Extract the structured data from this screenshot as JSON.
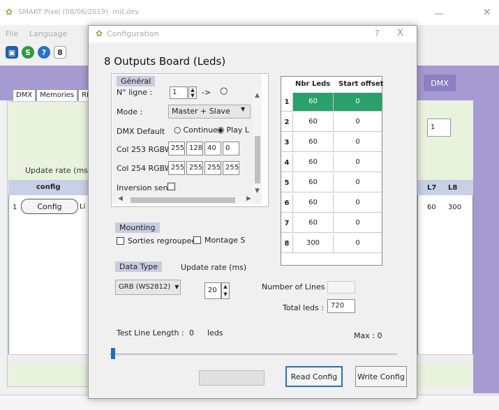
{
  "main_window": {
    "title": "SMART Pixel (08/06/2019)",
    "subtitle": "mit.dev",
    "menu": [
      "File",
      "Language"
    ],
    "toolbar_icons": [
      "save-icon",
      "s-icon",
      "help-icon",
      "8-icon"
    ],
    "tabs": [
      "DMX",
      "Memories",
      "RD"
    ],
    "update_rate_label": "Update rate (ms)",
    "table": {
      "config_header": "config",
      "row_index": "1",
      "config_button": "Config",
      "row_partial": "Li",
      "l7_header": "L7",
      "l8_header": "L8",
      "l7_value": "60",
      "l8_value": "300"
    },
    "dmx_button": "DMX",
    "right_spin_value": "1"
  },
  "dialog": {
    "title": "Configuration",
    "help": "?",
    "close": "X",
    "heading": "8 Outputs Board (Leds)",
    "general": {
      "header": "Général",
      "ligne_label": "N° ligne :",
      "ligne_value": "1",
      "ligne_arrow": "->",
      "mode_label": "Mode :",
      "mode_value": "Master + Slave",
      "dmx_default_label": "DMX Default",
      "dmx_options": [
        "Continue",
        "Play L"
      ],
      "dmx_selected": "Play L",
      "col253_label": "Col 253 RGBW",
      "col253_values": [
        "255",
        "128",
        "40",
        "0"
      ],
      "col254_label": "Col 254 RGBW",
      "col254_values": [
        "255",
        "255",
        "255",
        "255"
      ],
      "inversion_label": "Inversion sens"
    },
    "mounting": {
      "header": "Mounting",
      "sorties_label": "Sorties regroupee",
      "montage_label": "Montage S"
    },
    "data_type": {
      "header": "Data Type",
      "selected": "GRB (WS2812)",
      "update_rate_label": "Update rate (ms)",
      "update_rate_value": "20"
    },
    "number_of_lines_label": "Number of Lines :",
    "total_leds_label": "Total leds :",
    "total_leds_value": "720",
    "test_line_label": "Test Line Length :",
    "test_line_value": "0",
    "test_line_unit": "leds",
    "max_label": "Max : 0",
    "slider_value": 0,
    "buttons": {
      "read": "Read Config",
      "write": "Write Config"
    },
    "outputs_table": {
      "headers": [
        "Nbr Leds",
        "Start offset"
      ],
      "rows": [
        {
          "idx": "1",
          "nbr": "60",
          "offset": "0"
        },
        {
          "idx": "2",
          "nbr": "60",
          "offset": "0"
        },
        {
          "idx": "3",
          "nbr": "60",
          "offset": "0"
        },
        {
          "idx": "4",
          "nbr": "60",
          "offset": "0"
        },
        {
          "idx": "5",
          "nbr": "60",
          "offset": "0"
        },
        {
          "idx": "6",
          "nbr": "60",
          "offset": "0"
        },
        {
          "idx": "7",
          "nbr": "60",
          "offset": "0"
        },
        {
          "idx": "8",
          "nbr": "300",
          "offset": "0"
        }
      ],
      "selected_row": 0,
      "selected_color": "#2aa06a"
    }
  },
  "colors": {
    "purple": "#a69bd1",
    "green_panel": "#e8f2dc",
    "accent_blue": "#2a6fbf"
  }
}
